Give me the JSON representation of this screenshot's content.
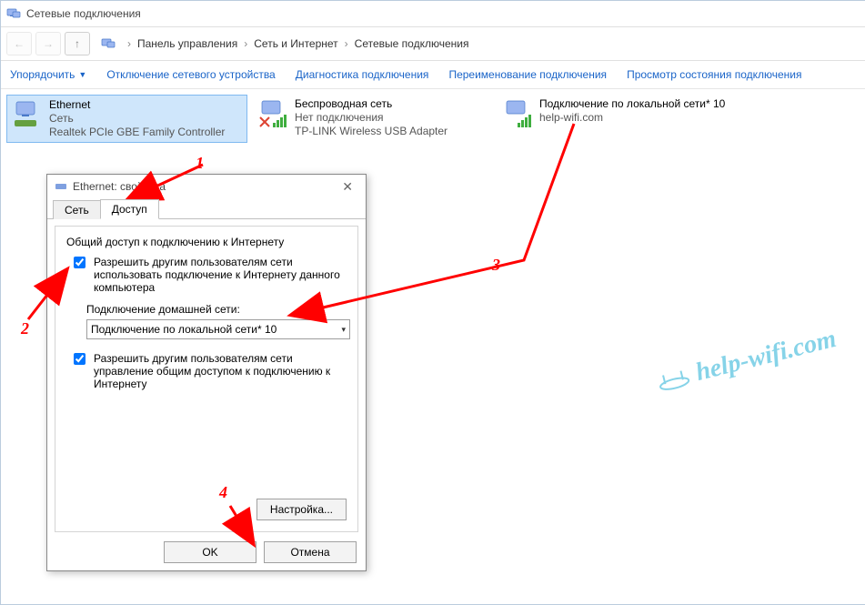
{
  "title": "Сетевые подключения",
  "breadcrumb": {
    "parts": [
      "Панель управления",
      "Сеть и Интернет",
      "Сетевые подключения"
    ]
  },
  "commands": {
    "organize": "Упорядочить",
    "disable": "Отключение сетевого устройства",
    "diagnose": "Диагностика подключения",
    "rename": "Переименование подключения",
    "status": "Просмотр состояния подключения"
  },
  "connections": [
    {
      "name": "Ethernet",
      "line2": "Сеть",
      "line3": "Realtek PCIe GBE Family Controller"
    },
    {
      "name": "Беспроводная сеть",
      "line2": "Нет подключения",
      "line3": "TP-LINK Wireless USB Adapter"
    },
    {
      "name": "Подключение по локальной сети* 10",
      "line2": "help-wifi.com",
      "line3": ""
    }
  ],
  "dialog": {
    "title": "Ethernet: свойства",
    "tabs": {
      "network": "Сеть",
      "sharing": "Доступ"
    },
    "group": "Общий доступ к подключению к Интернету",
    "chk1": "Разрешить другим пользователям сети использовать подключение к Интернету данного компьютера",
    "homenet_label": "Подключение домашней сети:",
    "homenet_value": "Подключение по локальной сети* 10",
    "chk2": "Разрешить другим пользователям сети управление общим доступом к подключению к Интернету",
    "settings_btn": "Настройка...",
    "ok": "OK",
    "cancel": "Отмена"
  },
  "annotations": {
    "n1": "1",
    "n2": "2",
    "n3": "3",
    "n4": "4"
  },
  "watermark": "help-wifi.com"
}
